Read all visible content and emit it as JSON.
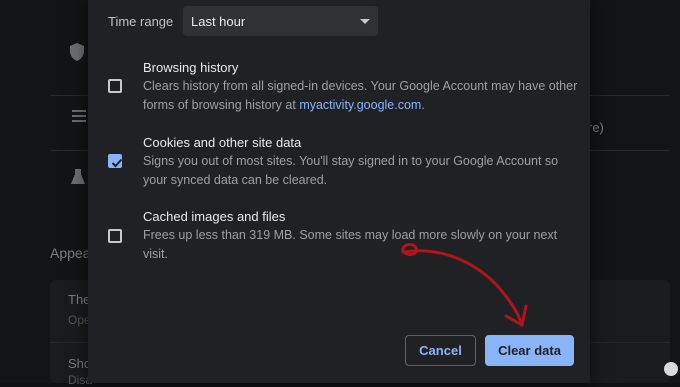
{
  "background": {
    "appearance_heading": "Appea",
    "rows": [
      {
        "title": "The",
        "subtitle": "Ope"
      },
      {
        "title": "Sho",
        "subtitle": "Disa"
      }
    ],
    "right_fragment": "re)",
    "icons": [
      "shield-icon",
      "tune-icon",
      "flask-icon"
    ]
  },
  "dialog": {
    "time_range": {
      "label": "Time range",
      "selected": "Last hour"
    },
    "options": [
      {
        "title": "Browsing history",
        "desc_before": "Clears history from all signed-in devices. Your Google Account may have other forms of browsing history at ",
        "link": "myactivity.google.com",
        "desc_after": ".",
        "checked": false
      },
      {
        "title": "Cookies and other site data",
        "desc_before": "Signs you out of most sites. You'll stay signed in to your Google Account so your synced data can be cleared.",
        "link": "",
        "desc_after": "",
        "checked": true
      },
      {
        "title": "Cached images and files",
        "desc_before": "Frees up less than 319 MB. Some sites may load more slowly on your next visit.",
        "link": "",
        "desc_after": "",
        "checked": false
      }
    ],
    "buttons": {
      "cancel": "Cancel",
      "clear": "Clear data"
    }
  },
  "colors": {
    "accent": "#8ab4f8",
    "dialog_bg": "#202124",
    "annotation_arrow": "#b0141c"
  }
}
